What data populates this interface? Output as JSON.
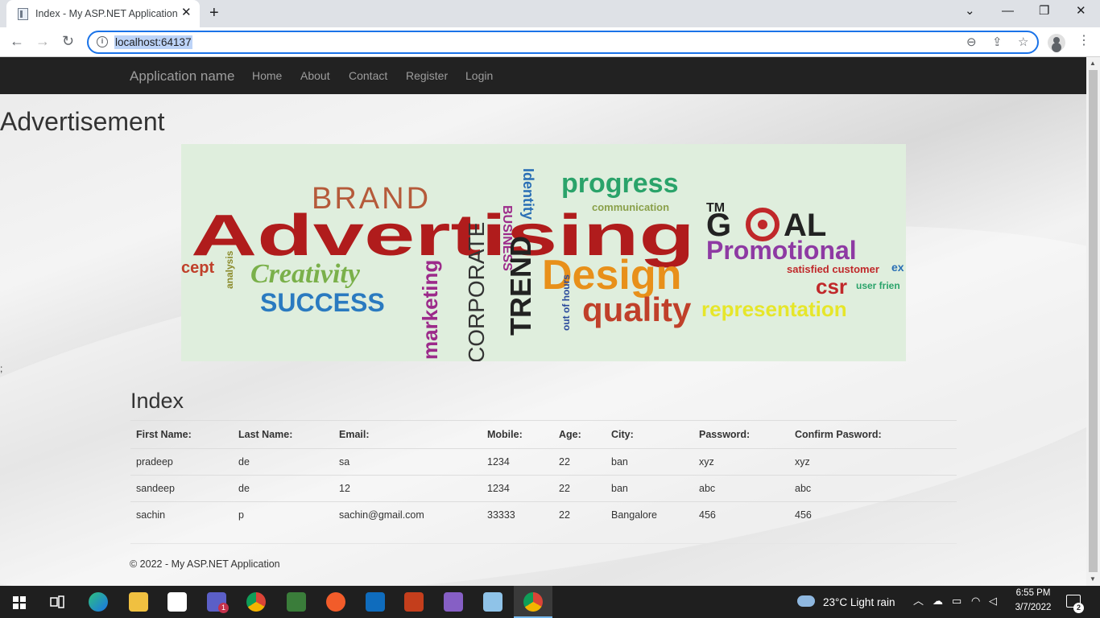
{
  "browser": {
    "tab_title": "Index - My ASP.NET Application",
    "tab_close_glyph": "✕",
    "new_tab_glyph": "+",
    "url": "localhost:64137",
    "window_controls": {
      "dropdown": "⌄",
      "minimize": "—",
      "restore": "❐",
      "close": "✕"
    },
    "nav_glyphs": {
      "back": "←",
      "forward": "→",
      "reload": "↻"
    },
    "omni_glyphs": {
      "zoom": "⊖",
      "share": "⇪",
      "bookmark": "☆"
    },
    "menu_glyph": "⋮"
  },
  "navbar": {
    "brand": "Application name",
    "links": [
      "Home",
      "About",
      "Contact",
      "Register",
      "Login"
    ]
  },
  "ad": {
    "heading": "Advertisement",
    "words": {
      "brand": "BRAND",
      "business": "BUSINESS",
      "identity": "Identity",
      "progress": "progress",
      "communication": "communication",
      "tm": "TM",
      "advertising": "Advertising",
      "goal_g": "G",
      "goal_al": "AL",
      "promotional": "Promotional",
      "cept": "cept",
      "analysis": "analysis",
      "creativity": "Creativity",
      "corporate": "CORPORATE",
      "trend": "TREND",
      "design": "Design",
      "satisfied": "satisfied customer",
      "ex": "ex",
      "csr": "csr",
      "user_friendly": "user frien",
      "success": "SUCCESS",
      "marketing": "marketing",
      "out_of_hours": "out of hours",
      "quality": "quality",
      "representation": "representation"
    }
  },
  "semicolon": ";",
  "index": {
    "heading": "Index",
    "columns": [
      "First Name:",
      "Last Name:",
      "Email:",
      "Mobile:",
      "Age:",
      "City:",
      "Password:",
      "Confirm Pasword:"
    ],
    "rows": [
      [
        "pradeep",
        "de",
        "sa",
        "1234",
        "22",
        "ban",
        "xyz",
        "xyz"
      ],
      [
        "sandeep",
        "de",
        "12",
        "1234",
        "22",
        "ban",
        "abc",
        "abc"
      ],
      [
        "sachin",
        "p",
        "sachin@gmail.com",
        "33333",
        "22",
        "Bangalore",
        "456",
        "456"
      ]
    ]
  },
  "footer": "© 2022 - My ASP.NET Application",
  "taskbar": {
    "weather": "23°C  Light rain",
    "time": "6:55 PM",
    "date": "3/7/2022",
    "notification_count": "2",
    "teams_badge": "1"
  }
}
